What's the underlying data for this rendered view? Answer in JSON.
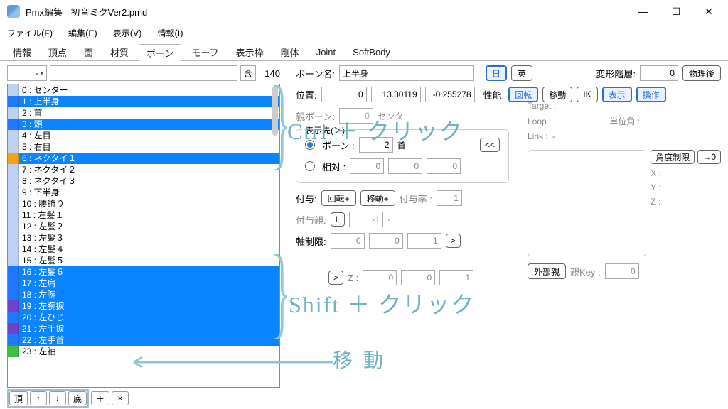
{
  "window": {
    "title": "Pmx編集 - 初音ミクVer2.pmd"
  },
  "menubar": [
    {
      "label": "ファイル",
      "key": "F"
    },
    {
      "label": "編集",
      "key": "E"
    },
    {
      "label": "表示",
      "key": "V"
    },
    {
      "label": "情報",
      "key": "I"
    }
  ],
  "tabs": [
    "情報",
    "頂点",
    "面",
    "材質",
    "ボーン",
    "モーフ",
    "表示枠",
    "剛体",
    "Joint",
    "SoftBody"
  ],
  "active_tab": "ボーン",
  "left": {
    "combo": "-",
    "filter": "",
    "toggle": "含",
    "count": "140",
    "bones": [
      {
        "idx": 0,
        "name": "センター",
        "color": "#bdd2f2",
        "selected": false
      },
      {
        "idx": 1,
        "name": "上半身",
        "color": "#1f78ff",
        "selected": true
      },
      {
        "idx": 2,
        "name": "首",
        "color": "#bdd2f2",
        "selected": false
      },
      {
        "idx": 3,
        "name": "頭",
        "color": "#1f78ff",
        "selected": true
      },
      {
        "idx": 4,
        "name": "左目",
        "color": "#bdd2f2",
        "selected": false
      },
      {
        "idx": 5,
        "name": "右目",
        "color": "#bdd2f2",
        "selected": false
      },
      {
        "idx": 6,
        "name": "ネクタイ１",
        "color": "#f2a21a",
        "selected": true
      },
      {
        "idx": 7,
        "name": "ネクタイ２",
        "color": "#bdd2f2",
        "selected": false
      },
      {
        "idx": 8,
        "name": "ネクタイ３",
        "color": "#bdd2f2",
        "selected": false
      },
      {
        "idx": 9,
        "name": "下半身",
        "color": "#bdd2f2",
        "selected": false
      },
      {
        "idx": 10,
        "name": "腰飾り",
        "color": "#bdd2f2",
        "selected": false
      },
      {
        "idx": 11,
        "name": "左髪１",
        "color": "#bdd2f2",
        "selected": false
      },
      {
        "idx": 12,
        "name": "左髪２",
        "color": "#bdd2f2",
        "selected": false
      },
      {
        "idx": 13,
        "name": "左髪３",
        "color": "#bdd2f2",
        "selected": false
      },
      {
        "idx": 14,
        "name": "左髪４",
        "color": "#bdd2f2",
        "selected": false
      },
      {
        "idx": 15,
        "name": "左髪５",
        "color": "#bdd2f2",
        "selected": false
      },
      {
        "idx": 16,
        "name": "左髪６",
        "color": "#1f78ff",
        "selected": true
      },
      {
        "idx": 17,
        "name": "左肩",
        "color": "#1f78ff",
        "selected": true
      },
      {
        "idx": 18,
        "name": "左腕",
        "color": "#1f78ff",
        "selected": true
      },
      {
        "idx": 19,
        "name": "左腕捩",
        "color": "#6f43c8",
        "selected": true
      },
      {
        "idx": 20,
        "name": "左ひじ",
        "color": "#1f78ff",
        "selected": true
      },
      {
        "idx": 21,
        "name": "左手捩",
        "color": "#6f43c8",
        "selected": true
      },
      {
        "idx": 22,
        "name": "左手首",
        "color": "#1f78ff",
        "selected": true
      },
      {
        "idx": 23,
        "name": "左袖",
        "color": "#3fbf3f",
        "selected": false
      }
    ],
    "toolbar": {
      "top": "頂",
      "up": "↑",
      "down": "↓",
      "bottom": "底",
      "add": "＋",
      "remove": "×"
    }
  },
  "details": {
    "name_label": "ボーン名:",
    "name_value": "上半身",
    "jp": "日",
    "en": "英",
    "deform_label": "変形階層:",
    "deform_value": "0",
    "physics": "物理後",
    "pos_label": "位置:",
    "pos_x": "0",
    "pos_y": "13.30119",
    "pos_z": "-0.255278",
    "ability_label": "性能:",
    "rotate": "回転",
    "move": "移動",
    "ik": "IK",
    "display": "表示",
    "operate": "操作",
    "parent_label": "親ボーン:",
    "parent_idx": "0",
    "parent_name": "センター",
    "dest_group": "表示先(＞)",
    "dest_bone_label": "ボーン :",
    "dest_bone_idx": "2",
    "dest_bone_name": "首",
    "dest_rel_label": "相対 :",
    "dest_rel_x": "0",
    "dest_rel_y": "0",
    "dest_rel_z": "0",
    "grant_label": "付与:",
    "grant_rotate": "回転+",
    "grant_move": "移動+",
    "grant_rate_label": "付与率 :",
    "grant_rate": "1",
    "grant_parent_label": "付与親:",
    "grant_parent_btn": "L",
    "grant_parent_idx": "-1",
    "grant_parent_name": "-",
    "axis_label": "軸制限:",
    "axis_x": "0",
    "axis_y": "0",
    "axis_z": "1",
    "local_z": "Z :",
    "local_z_x": "0",
    "local_z_y": "0",
    "local_z_z": "1",
    "ik_target": "Target :",
    "ik_loop": "Loop :",
    "ik_unit": "単位角 :",
    "ik_link": "Link :",
    "ik_link_val": "-",
    "angle_limit": "角度制限",
    "angle_to0": "→0",
    "X": "X :",
    "Y": "Y :",
    "Z": "Z :",
    "ext_parent": "外部親",
    "key": "親Key :",
    "key_val": "0",
    "revert": "<<",
    "next": ">"
  },
  "annotations": {
    "ctrl": "Ctrl ＋ クリック",
    "shift": "Shift ＋ クリック",
    "move": "移 動"
  }
}
